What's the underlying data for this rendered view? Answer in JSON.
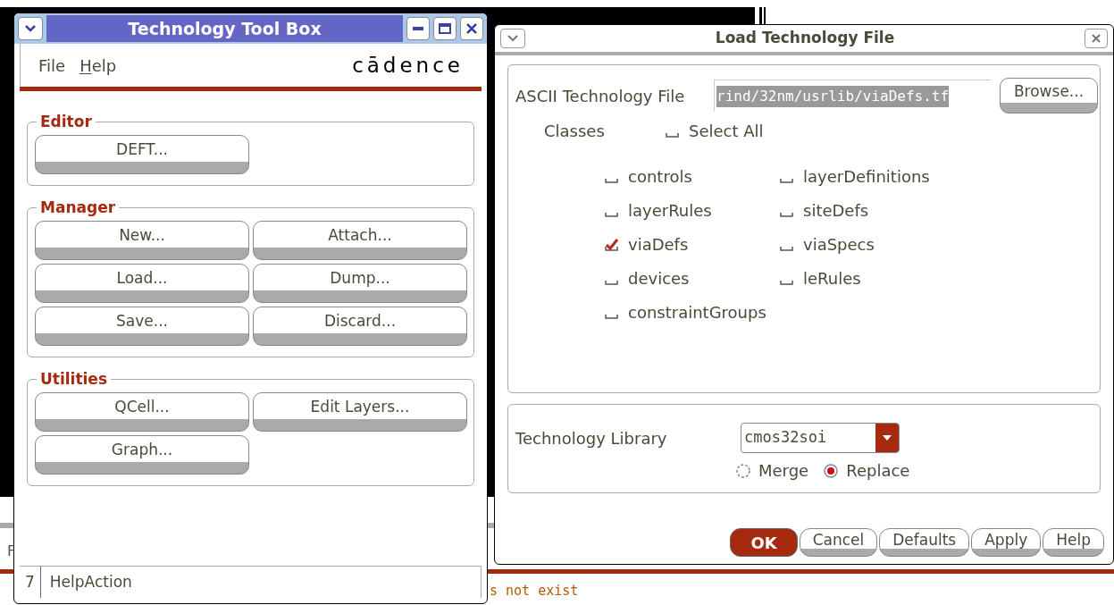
{
  "console": {
    "fragments": [
      "F",
      "s not exist"
    ]
  },
  "toolbox": {
    "title": "Technology Tool Box",
    "menu": [
      "File",
      "Help"
    ],
    "logo": "cādence",
    "groups": [
      {
        "title": "Editor",
        "buttons": [
          "DEFT..."
        ]
      },
      {
        "title": "Manager",
        "buttons": [
          "New...",
          "Attach...",
          "Load...",
          "Dump...",
          "Save...",
          "Discard..."
        ]
      },
      {
        "title": "Utilities",
        "buttons": [
          "QCell...",
          "Edit Layers...",
          "Graph..."
        ]
      }
    ],
    "status_bar": {
      "number": "7",
      "text": "HelpAction"
    }
  },
  "dialog": {
    "title": "Load Technology File",
    "file_label": "ASCII Technology File",
    "file_value": "rind/32nm/usrlib/viaDefs.tf",
    "browse": "Browse...",
    "classes_label": "Classes",
    "select_all": {
      "label": "Select All",
      "checked": false
    },
    "classes": [
      {
        "label": "controls",
        "checked": false
      },
      {
        "label": "layerDefinitions",
        "checked": false
      },
      {
        "label": "layerRules",
        "checked": false
      },
      {
        "label": "siteDefs",
        "checked": false
      },
      {
        "label": "viaDefs",
        "checked": true
      },
      {
        "label": "viaSpecs",
        "checked": false
      },
      {
        "label": "devices",
        "checked": false
      },
      {
        "label": "leRules",
        "checked": false
      },
      {
        "label": "constraintGroups",
        "checked": false
      }
    ],
    "library_label": "Technology Library",
    "library_value": "cmos32soi",
    "modes": [
      {
        "label": "Merge",
        "selected": false
      },
      {
        "label": "Replace",
        "selected": true
      }
    ],
    "buttons": [
      {
        "label": "OK",
        "kind": "primary"
      },
      {
        "label": "Cancel",
        "kind": "normal"
      },
      {
        "label": "Defaults",
        "kind": "normal"
      },
      {
        "label": "Apply",
        "kind": "normal"
      },
      {
        "label": "Help",
        "kind": "normal"
      }
    ]
  }
}
